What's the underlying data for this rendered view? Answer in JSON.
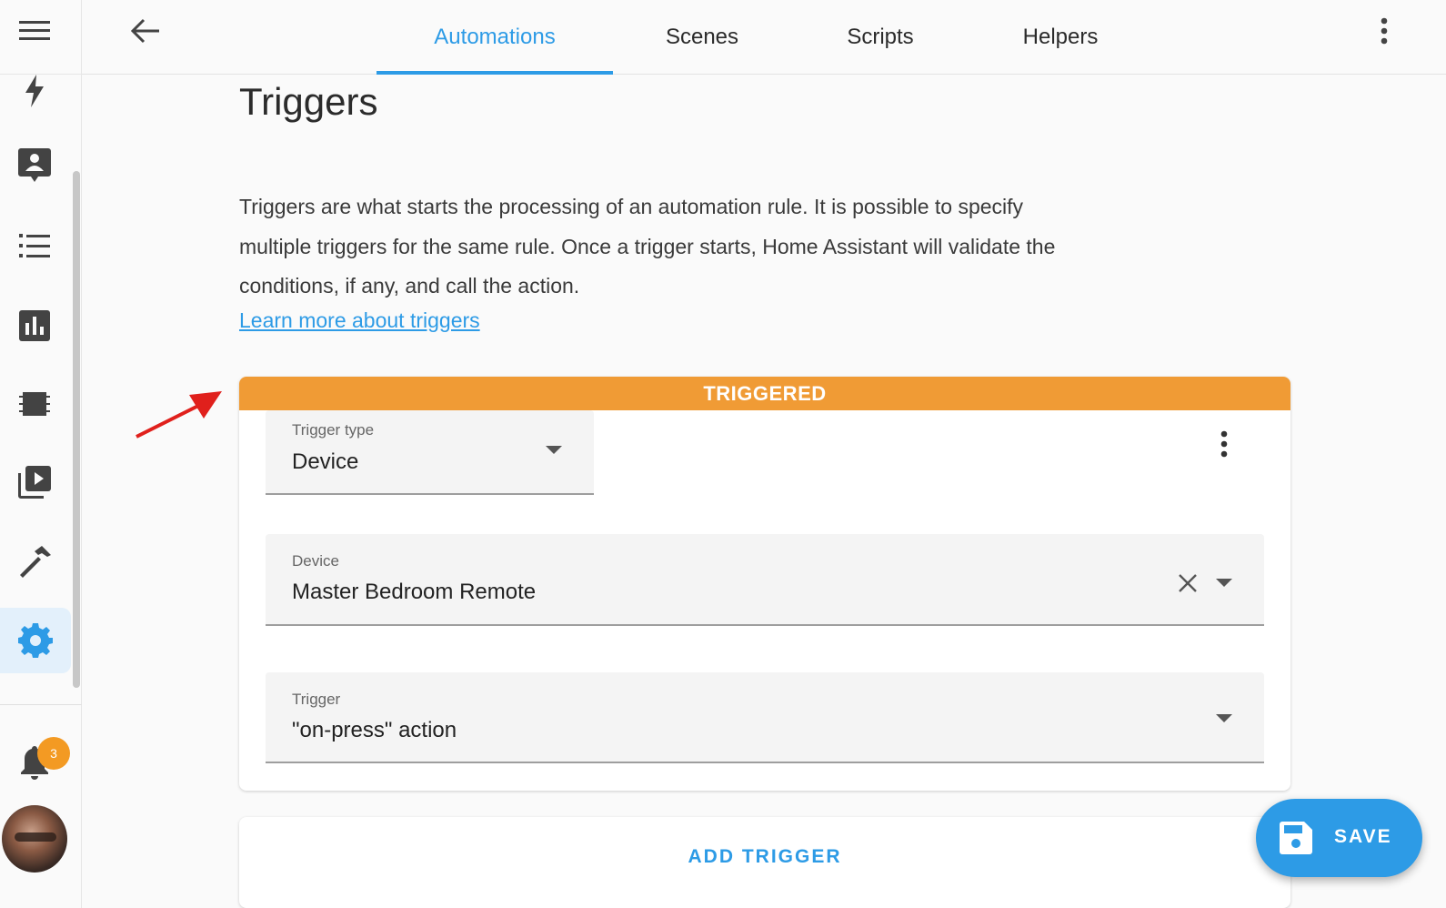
{
  "sidebar": {
    "items": [
      {
        "icon": "menu-icon"
      },
      {
        "icon": "lightning-icon"
      },
      {
        "icon": "account-box-icon"
      },
      {
        "icon": "format-list-icon"
      },
      {
        "icon": "chart-box-icon"
      },
      {
        "icon": "memory-icon"
      },
      {
        "icon": "play-box-icon"
      },
      {
        "icon": "hammer-icon"
      },
      {
        "icon": "cog-icon",
        "active": true
      }
    ],
    "notification_count": "3"
  },
  "header": {
    "tabs": [
      {
        "label": "Automations",
        "active": true
      },
      {
        "label": "Scenes"
      },
      {
        "label": "Scripts"
      },
      {
        "label": "Helpers"
      }
    ]
  },
  "main": {
    "title": "Triggers",
    "description": "Triggers are what starts the processing of an automation rule. It is possible to specify multiple triggers for the same rule. Once a trigger starts, Home Assistant will validate the conditions, if any, and call the action.",
    "link_text": "Learn more about triggers",
    "trigger_card": {
      "status": "TRIGGERED",
      "trigger_type": {
        "label": "Trigger type",
        "value": "Device"
      },
      "device": {
        "label": "Device",
        "value": "Master Bedroom Remote"
      },
      "trigger": {
        "label": "Trigger",
        "value": "\"on-press\" action"
      }
    },
    "add_trigger_label": "ADD TRIGGER",
    "save_label": "SAVE"
  },
  "colors": {
    "accent": "#2d9be6",
    "triggered": "#f09b35",
    "badge": "#f39a23"
  }
}
